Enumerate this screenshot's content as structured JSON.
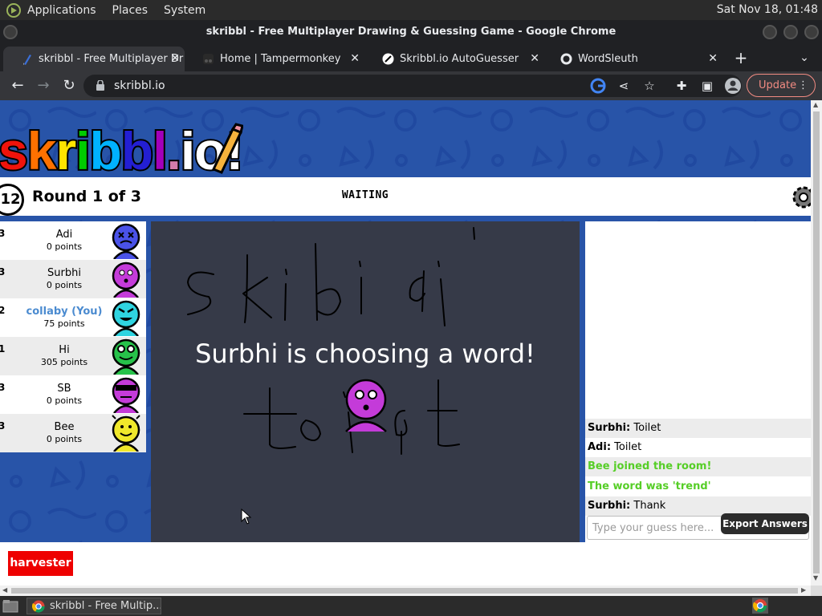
{
  "top_panel": {
    "menus": [
      "Applications",
      "Places",
      "System"
    ],
    "clock": "Sat Nov 18, 01:48"
  },
  "window": {
    "title": "skribbl - Free Multiplayer Drawing & Guessing Game - Google Chrome"
  },
  "tabs": [
    {
      "label": "skribbl - Free Multiplayer Dr",
      "icon": "skribbl-pencil-icon",
      "active": true
    },
    {
      "label": "Home | Tampermonkey",
      "icon": "tampermonkey-icon",
      "active": false
    },
    {
      "label": "Skribbl.io AutoGuesser",
      "icon": "greasyfork-icon",
      "active": false
    },
    {
      "label": "WordSleuth",
      "icon": "github-icon",
      "active": false
    }
  ],
  "address_bar": {
    "url": "skribbl.io",
    "update_label": "Update"
  },
  "game": {
    "logo_text": "skribbl.io!",
    "timer": "12",
    "round": "Round 1 of 3",
    "status": "WAITING",
    "overlay_text": "Surbhi is choosing a word!",
    "canvas_doodles": [
      "skibidi",
      "toilet"
    ],
    "players": [
      {
        "rank": "3",
        "name": "Adi",
        "points": "0 points",
        "avatar_color": "#4a52e8",
        "you": false
      },
      {
        "rank": "3",
        "name": "Surbhi",
        "points": "0 points",
        "avatar_color": "#c43bd9",
        "you": false
      },
      {
        "rank": "2",
        "name": "collaby (You)",
        "points": "75 points",
        "avatar_color": "#2fd4e0",
        "you": true
      },
      {
        "rank": "1",
        "name": "Hi",
        "points": "305 points",
        "avatar_color": "#27c24a",
        "you": false
      },
      {
        "rank": "3",
        "name": "SB",
        "points": "0 points",
        "avatar_color": "#c43bd9",
        "you": false
      },
      {
        "rank": "3",
        "name": "Bee",
        "points": "0 points",
        "avatar_color": "#f0e82b",
        "you": false
      }
    ],
    "chat": [
      {
        "author": "Surbhi:",
        "text": " Toilet",
        "system": false
      },
      {
        "author": "Adi:",
        "text": " Toilet",
        "system": false
      },
      {
        "author": "",
        "text": "Bee joined the room!",
        "system": true
      },
      {
        "author": "",
        "text": "The word was 'trend'",
        "system": true
      },
      {
        "author": "Surbhi:",
        "text": " Thank",
        "system": false
      }
    ],
    "guess_placeholder": "Type your guess here...",
    "export_label": "Export Answers",
    "harvester_label": "harvester"
  },
  "taskbar": {
    "task_label": "skribbl - Free Multip..."
  }
}
